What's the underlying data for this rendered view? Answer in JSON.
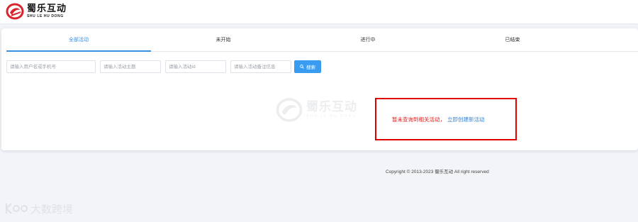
{
  "header": {
    "logo_cn": "蜀乐互动",
    "logo_en": "SHU LE HU DONG"
  },
  "tabs": [
    {
      "label": "全部活动",
      "active": true
    },
    {
      "label": "未开始",
      "active": false
    },
    {
      "label": "进行中",
      "active": false
    },
    {
      "label": "已结束",
      "active": false
    }
  ],
  "filters": {
    "user_placeholder": "请输入用户名或手机号",
    "subject_placeholder": "请输入活动主题",
    "id_placeholder": "请输入活动id",
    "note_placeholder": "请输入活动备注信息",
    "search_label": "搜索",
    "search_icon": "search-icon"
  },
  "empty_state": {
    "watermark_cn": "蜀乐互动",
    "watermark_en": "SHU LE HU DONG",
    "message": "暂未查询到相关活动，",
    "create_link": "立即创建新活动"
  },
  "footer": {
    "copyright": "Copyright © 2013-2023 蜀乐互动 All right reserved"
  },
  "corner_watermark": {
    "text": "大数跨境"
  },
  "colors": {
    "accent": "#3a8ee6",
    "search_button": "#3a9cf0",
    "highlight_border": "#e00000",
    "empty_message": "#e02020",
    "brand_red": "#d9232d"
  }
}
